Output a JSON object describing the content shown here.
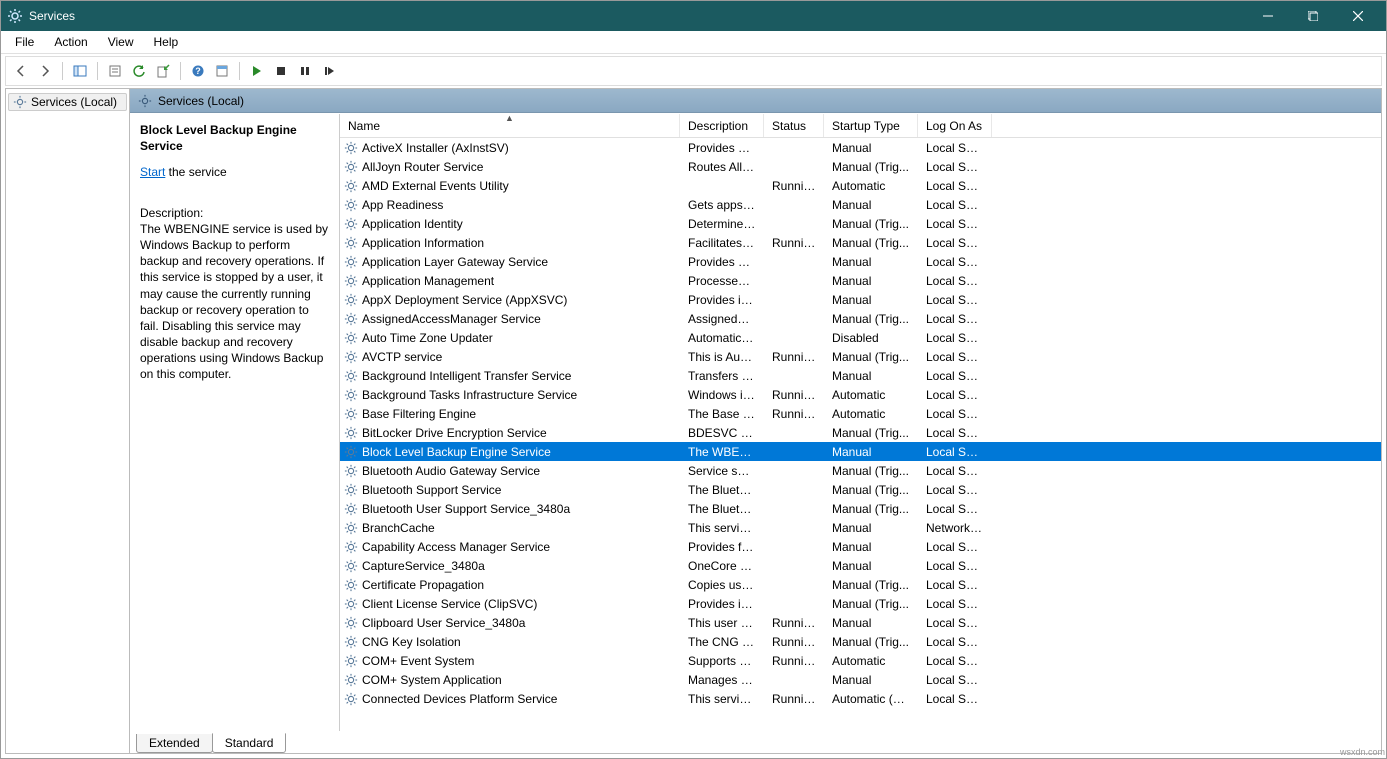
{
  "window": {
    "title": "Services"
  },
  "menu": {
    "items": [
      "File",
      "Action",
      "View",
      "Help"
    ]
  },
  "tree": {
    "root": "Services (Local)"
  },
  "rightHeader": {
    "title": "Services (Local)"
  },
  "detail": {
    "serviceName": "Block Level Backup Engine Service",
    "startLink": "Start",
    "startSuffix": " the service",
    "descLabel": "Description:",
    "descText": "The WBENGINE service is used by Windows Backup to perform backup and recovery operations. If this service is stopped by a user, it may cause the currently running backup or recovery operation to fail. Disabling this service may disable backup and recovery operations using Windows Backup on this computer."
  },
  "columns": {
    "name": "Name",
    "description": "Description",
    "status": "Status",
    "startup": "Startup Type",
    "logon": "Log On As"
  },
  "tabs": {
    "extended": "Extended",
    "standard": "Standard"
  },
  "watermark": "wsxdn.com",
  "services": [
    {
      "name": "ActiveX Installer (AxInstSV)",
      "desc": "Provides Us...",
      "status": "",
      "startup": "Manual",
      "logon": "Local Syste...",
      "selected": false
    },
    {
      "name": "AllJoyn Router Service",
      "desc": "Routes AllJoy...",
      "status": "",
      "startup": "Manual (Trig...",
      "logon": "Local Service",
      "selected": false
    },
    {
      "name": "AMD External Events Utility",
      "desc": "",
      "status": "Running",
      "startup": "Automatic",
      "logon": "Local Syste...",
      "selected": false
    },
    {
      "name": "App Readiness",
      "desc": "Gets apps re...",
      "status": "",
      "startup": "Manual",
      "logon": "Local Syste...",
      "selected": false
    },
    {
      "name": "Application Identity",
      "desc": "Determines ...",
      "status": "",
      "startup": "Manual (Trig...",
      "logon": "Local Service",
      "selected": false
    },
    {
      "name": "Application Information",
      "desc": "Facilitates t...",
      "status": "Running",
      "startup": "Manual (Trig...",
      "logon": "Local Syste...",
      "selected": false
    },
    {
      "name": "Application Layer Gateway Service",
      "desc": "Provides su...",
      "status": "",
      "startup": "Manual",
      "logon": "Local Service",
      "selected": false
    },
    {
      "name": "Application Management",
      "desc": "Processes in...",
      "status": "",
      "startup": "Manual",
      "logon": "Local Syste...",
      "selected": false
    },
    {
      "name": "AppX Deployment Service (AppXSVC)",
      "desc": "Provides inf...",
      "status": "",
      "startup": "Manual",
      "logon": "Local Syste...",
      "selected": false
    },
    {
      "name": "AssignedAccessManager Service",
      "desc": "AssignedAc...",
      "status": "",
      "startup": "Manual (Trig...",
      "logon": "Local Syste...",
      "selected": false
    },
    {
      "name": "Auto Time Zone Updater",
      "desc": "Automatica...",
      "status": "",
      "startup": "Disabled",
      "logon": "Local Service",
      "selected": false
    },
    {
      "name": "AVCTP service",
      "desc": "This is Audi...",
      "status": "Running",
      "startup": "Manual (Trig...",
      "logon": "Local Service",
      "selected": false
    },
    {
      "name": "Background Intelligent Transfer Service",
      "desc": "Transfers fil...",
      "status": "",
      "startup": "Manual",
      "logon": "Local Syste...",
      "selected": false
    },
    {
      "name": "Background Tasks Infrastructure Service",
      "desc": "Windows in...",
      "status": "Running",
      "startup": "Automatic",
      "logon": "Local Syste...",
      "selected": false
    },
    {
      "name": "Base Filtering Engine",
      "desc": "The Base Fil...",
      "status": "Running",
      "startup": "Automatic",
      "logon": "Local Service",
      "selected": false
    },
    {
      "name": "BitLocker Drive Encryption Service",
      "desc": "BDESVC hos...",
      "status": "",
      "startup": "Manual (Trig...",
      "logon": "Local Syste...",
      "selected": false
    },
    {
      "name": "Block Level Backup Engine Service",
      "desc": "The WBENG...",
      "status": "",
      "startup": "Manual",
      "logon": "Local Syste...",
      "selected": true
    },
    {
      "name": "Bluetooth Audio Gateway Service",
      "desc": "Service sup...",
      "status": "",
      "startup": "Manual (Trig...",
      "logon": "Local Service",
      "selected": false
    },
    {
      "name": "Bluetooth Support Service",
      "desc": "The Bluetoo...",
      "status": "",
      "startup": "Manual (Trig...",
      "logon": "Local Service",
      "selected": false
    },
    {
      "name": "Bluetooth User Support Service_3480a",
      "desc": "The Bluetoo...",
      "status": "",
      "startup": "Manual (Trig...",
      "logon": "Local Syste...",
      "selected": false
    },
    {
      "name": "BranchCache",
      "desc": "This service ...",
      "status": "",
      "startup": "Manual",
      "logon": "Network S...",
      "selected": false
    },
    {
      "name": "Capability Access Manager Service",
      "desc": "Provides fac...",
      "status": "",
      "startup": "Manual",
      "logon": "Local Syste...",
      "selected": false
    },
    {
      "name": "CaptureService_3480a",
      "desc": "OneCore Ca...",
      "status": "",
      "startup": "Manual",
      "logon": "Local Syste...",
      "selected": false
    },
    {
      "name": "Certificate Propagation",
      "desc": "Copies user ...",
      "status": "",
      "startup": "Manual (Trig...",
      "logon": "Local Syste...",
      "selected": false
    },
    {
      "name": "Client License Service (ClipSVC)",
      "desc": "Provides inf...",
      "status": "",
      "startup": "Manual (Trig...",
      "logon": "Local Syste...",
      "selected": false
    },
    {
      "name": "Clipboard User Service_3480a",
      "desc": "This user se...",
      "status": "Running",
      "startup": "Manual",
      "logon": "Local Syste...",
      "selected": false
    },
    {
      "name": "CNG Key Isolation",
      "desc": "The CNG ke...",
      "status": "Running",
      "startup": "Manual (Trig...",
      "logon": "Local Syste...",
      "selected": false
    },
    {
      "name": "COM+ Event System",
      "desc": "Supports Sy...",
      "status": "Running",
      "startup": "Automatic",
      "logon": "Local Service",
      "selected": false
    },
    {
      "name": "COM+ System Application",
      "desc": "Manages th...",
      "status": "",
      "startup": "Manual",
      "logon": "Local Syste...",
      "selected": false
    },
    {
      "name": "Connected Devices Platform Service",
      "desc": "This service...",
      "status": "Running",
      "startup": "Automatic (D...",
      "logon": "Local Service",
      "selected": false
    }
  ]
}
